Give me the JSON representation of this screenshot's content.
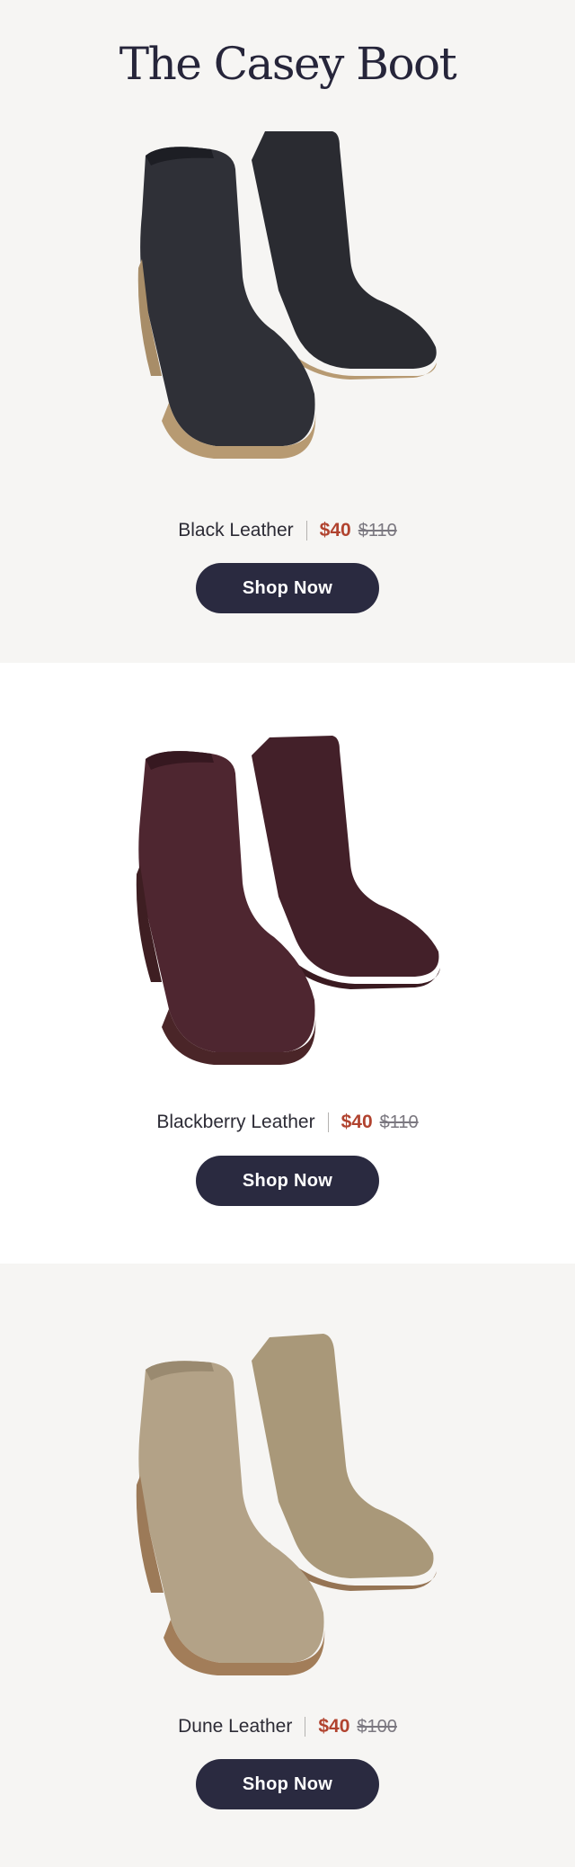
{
  "header": {
    "title": "The Casey Boot"
  },
  "products": [
    {
      "color_name": "Black Leather",
      "sale_price": "$40",
      "original_price": "$110",
      "cta_label": "Shop Now",
      "image": {
        "description": "pair of black leather wedge ankle boots",
        "shaft_color": "#2f3037",
        "shaft_shadow": "#1d1e24",
        "sole_color": "#b79a72"
      }
    },
    {
      "color_name": "Blackberry Leather",
      "sale_price": "$40",
      "original_price": "$110",
      "cta_label": "Shop Now",
      "image": {
        "description": "pair of blackberry (burgundy) leather wedge ankle boots",
        "shaft_color": "#4e2630",
        "shaft_shadow": "#361820",
        "sole_color": "#4a2528"
      }
    },
    {
      "color_name": "Dune Leather",
      "sale_price": "$40",
      "original_price": "$100",
      "cta_label": "Shop Now",
      "image": {
        "description": "pair of dune (tan suede) leather wedge ankle boots",
        "shaft_color": "#b3a287",
        "shaft_shadow": "#9a8a70",
        "sole_color": "#a27d59"
      }
    }
  ],
  "colors": {
    "section_bg_alt": "#f6f5f3",
    "section_bg": "#ffffff",
    "sale_price": "#b1432f",
    "button_bg": "#2a2a40",
    "button_text": "#ffffff",
    "title_text": "#26253a"
  }
}
